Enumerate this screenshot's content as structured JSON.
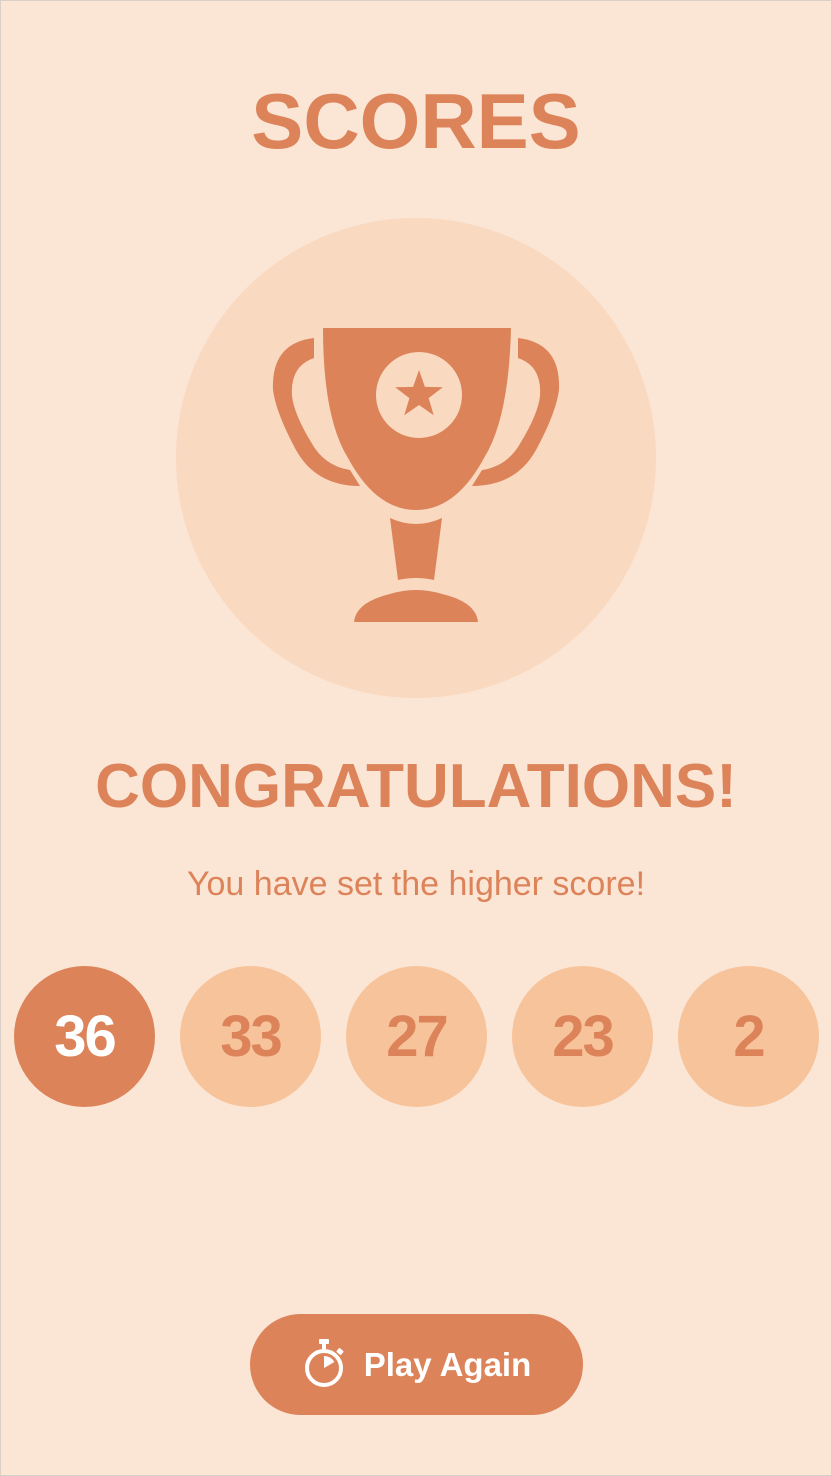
{
  "header": {
    "title": "SCORES"
  },
  "trophy": {
    "icon": "trophy-icon",
    "emblem": "star-icon"
  },
  "message": {
    "headline": "CONGRATULATIONS!",
    "subtitle": "You have set the higher score!"
  },
  "scores": {
    "items": [
      {
        "value": "36",
        "highlight": true
      },
      {
        "value": "33",
        "highlight": false
      },
      {
        "value": "27",
        "highlight": false
      },
      {
        "value": "23",
        "highlight": false
      },
      {
        "value": "2",
        "highlight": false
      }
    ]
  },
  "action": {
    "play_again_label": "Play Again",
    "icon": "stopwatch-icon"
  },
  "colors": {
    "background": "#fbe5d5",
    "accent": "#dc835a",
    "circle": "#f9d9c0",
    "score_bubble": "#f7c39b",
    "text_on_accent": "#ffffff"
  }
}
